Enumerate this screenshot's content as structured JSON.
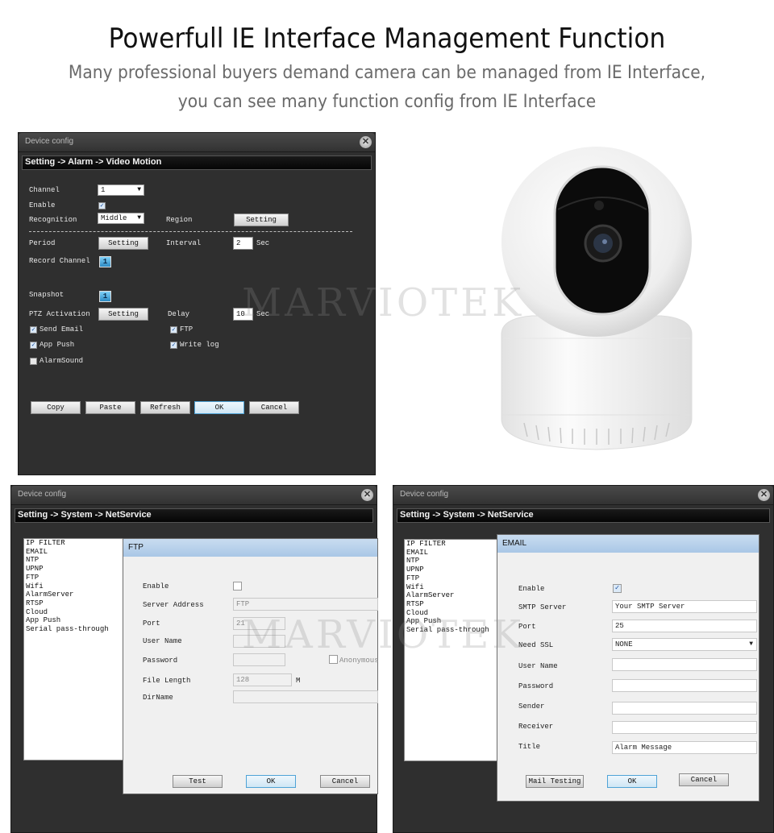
{
  "header": {
    "title": "Powerfull IE Interface Management Function",
    "subtitle_line1": "Many professional buyers demand camera can be managed from IE Interface,",
    "subtitle_line2": "you can see many function config from IE Interface"
  },
  "watermark": "MARVIOTEK",
  "window_motion": {
    "title": "Device config",
    "breadcrumb": "Setting -> Alarm -> Video Motion",
    "close_icon": "close-icon",
    "channel_label": "Channel",
    "channel_value": "1",
    "enable_label": "Enable",
    "enable_checked": true,
    "recognition_label": "Recognition",
    "recognition_value": "Middle",
    "region_label": "Region",
    "region_button": "Setting",
    "period_label": "Period",
    "period_button": "Setting",
    "interval_label": "Interval",
    "interval_value": "2",
    "interval_unit": "Sec",
    "record_channel_label": "Record Channel",
    "record_channel_value": "1",
    "snapshot_label": "Snapshot",
    "snapshot_value": "1",
    "ptz_label": "PTZ Activation",
    "ptz_button": "Setting",
    "delay_label": "Delay",
    "delay_value": "10",
    "delay_unit": "Sec",
    "checkboxes": [
      {
        "label": "Send Email",
        "checked": true
      },
      {
        "label": "FTP",
        "checked": true
      },
      {
        "label": "App Push",
        "checked": true
      },
      {
        "label": "Write log",
        "checked": true
      },
      {
        "label": "AlarmSound",
        "checked": false
      }
    ],
    "buttons": [
      "Copy",
      "Paste",
      "Refresh",
      "OK",
      "Cancel"
    ]
  },
  "window_ftp": {
    "title": "Device config",
    "breadcrumb": "Setting -> System -> NetService",
    "services": [
      "IP FILTER",
      "EMAIL",
      "NTP",
      "UPNP",
      "FTP",
      "Wifi",
      "AlarmServer",
      "RTSP",
      "Cloud",
      "App Push",
      "Serial pass-through"
    ],
    "dialog": {
      "title": "FTP",
      "enable_label": "Enable",
      "enable_checked": false,
      "server_label": "Server Address",
      "server_value": "FTP",
      "port_label": "Port",
      "port_value": "21",
      "user_label": "User Name",
      "user_value": "",
      "password_label": "Password",
      "password_value": "",
      "anonymous_label": "Anonymous",
      "anonymous_checked": false,
      "file_length_label": "File Length",
      "file_length_value": "128",
      "file_length_unit": "M",
      "dirname_label": "DirName",
      "dirname_value": "",
      "buttons": [
        "Test",
        "OK",
        "Cancel"
      ]
    }
  },
  "window_email": {
    "title": "Device config",
    "breadcrumb": "Setting -> System -> NetService",
    "services": [
      "IP FILTER",
      "EMAIL",
      "NTP",
      "UPNP",
      "FTP",
      "Wifi",
      "AlarmServer",
      "RTSP",
      "Cloud",
      "App Push",
      "Serial pass-through"
    ],
    "dialog": {
      "title": "EMAIL",
      "enable_label": "Enable",
      "enable_checked": true,
      "smtp_label": "SMTP Server",
      "smtp_value": "Your SMTP Server",
      "port_label": "Port",
      "port_value": "25",
      "ssl_label": "Need SSL",
      "ssl_value": "NONE",
      "user_label": "User Name",
      "user_value": "",
      "password_label": "Password",
      "password_value": "",
      "sender_label": "Sender",
      "sender_value": "",
      "receiver_label": "Receiver",
      "receiver_value": "",
      "title_label": "Title",
      "title_value": "Alarm Message",
      "buttons": [
        "Mail Testing",
        "OK",
        "Cancel"
      ]
    }
  },
  "product_image": "ptz-camera-image"
}
